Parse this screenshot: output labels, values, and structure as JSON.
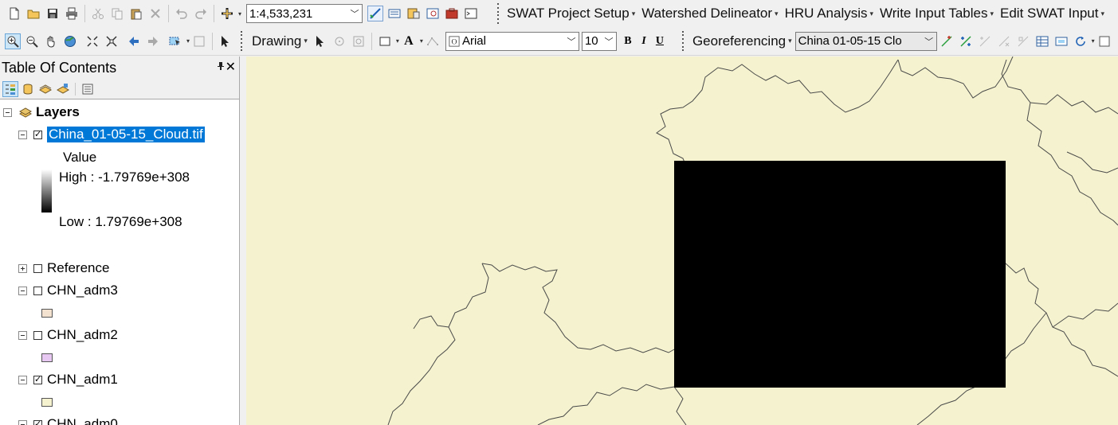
{
  "toolbar": {
    "scale": "1:4,533,231",
    "menus": [
      "SWAT Project Setup",
      "Watershed Delineator",
      "HRU Analysis",
      "Write Input Tables",
      "Edit SWAT Input"
    ],
    "drawing_label": "Drawing",
    "font_name": "Arial",
    "font_size": "10",
    "fmt_bold": "B",
    "fmt_italic": "I",
    "fmt_underline": "U",
    "text_tool": "A",
    "georef_label": "Georeferencing",
    "georef_layer": "China  01-05-15  Clo"
  },
  "toc": {
    "title": "Table Of Contents",
    "pin": "ᵖ",
    "close": "✕",
    "root": "Layers",
    "layers": [
      {
        "name": "China_01-05-15_Cloud.tif",
        "checked": true,
        "expanded": true,
        "selected": true
      },
      {
        "name": "Reference",
        "checked": false,
        "expanded": false
      },
      {
        "name": "CHN_adm3",
        "checked": false,
        "expanded": true,
        "swatch": "#f2e2cf"
      },
      {
        "name": "CHN_adm2",
        "checked": false,
        "expanded": true,
        "swatch": "#e7c8f3"
      },
      {
        "name": "CHN_adm1",
        "checked": true,
        "expanded": true,
        "swatch": "#f5f3cf"
      },
      {
        "name": "CHN_adm0",
        "checked": true,
        "expanded": true
      }
    ],
    "legend": {
      "field": "Value",
      "high": "High : -1.79769e+308",
      "low": "Low : 1.79769e+308"
    }
  },
  "colors": {
    "map_background": "#f5f3cf",
    "raster": "#000000",
    "boundary": "#4a4a4a",
    "selection": "#0078d7"
  }
}
